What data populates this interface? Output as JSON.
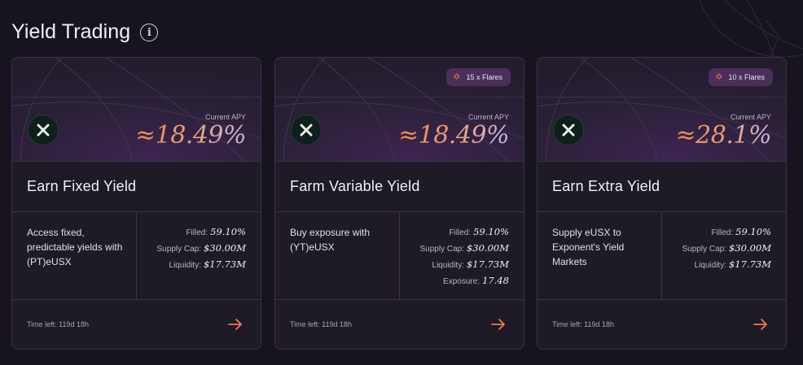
{
  "page": {
    "title": "Yield Trading"
  },
  "colors": {
    "accent": "#f07a4a",
    "card_border": "#3b3447",
    "badge_bg": "#4b2f5a"
  },
  "cards": [
    {
      "flares": "",
      "apy_label": "Current APY",
      "apy": "≈18.49%",
      "title": "Earn Fixed Yield",
      "description": "Access fixed, predictable yields with (PT)eUSX",
      "stats": {
        "filled_label": "Filled:",
        "filled": "59.10%",
        "supply_cap_label": "Supply Cap:",
        "supply_cap": "$30.00M",
        "liquidity_label": "Liquidity:",
        "liquidity": "$17.73M"
      },
      "time_left": "Time left: 119d 18h"
    },
    {
      "flares": "15 x Flares",
      "apy_label": "Current APY",
      "apy": "≈18.49%",
      "title": "Farm Variable Yield",
      "description": "Buy exposure with (YT)eUSX",
      "stats": {
        "filled_label": "Filled:",
        "filled": "59.10%",
        "supply_cap_label": "Supply Cap:",
        "supply_cap": "$30.00M",
        "liquidity_label": "Liquidity:",
        "liquidity": "$17.73M",
        "exposure_label": "Exposure:",
        "exposure": "17.48"
      },
      "time_left": "Time left: 119d 18h"
    },
    {
      "flares": "10 x Flares",
      "apy_label": "Current APY",
      "apy": "≈28.1%",
      "title": "Earn Extra Yield",
      "description": "Supply eUSX to Exponent's Yield Markets",
      "stats": {
        "filled_label": "Filled:",
        "filled": "59.10%",
        "supply_cap_label": "Supply Cap:",
        "supply_cap": "$30.00M",
        "liquidity_label": "Liquidity:",
        "liquidity": "$17.73M"
      },
      "time_left": "Time left: 119d 18h"
    }
  ]
}
